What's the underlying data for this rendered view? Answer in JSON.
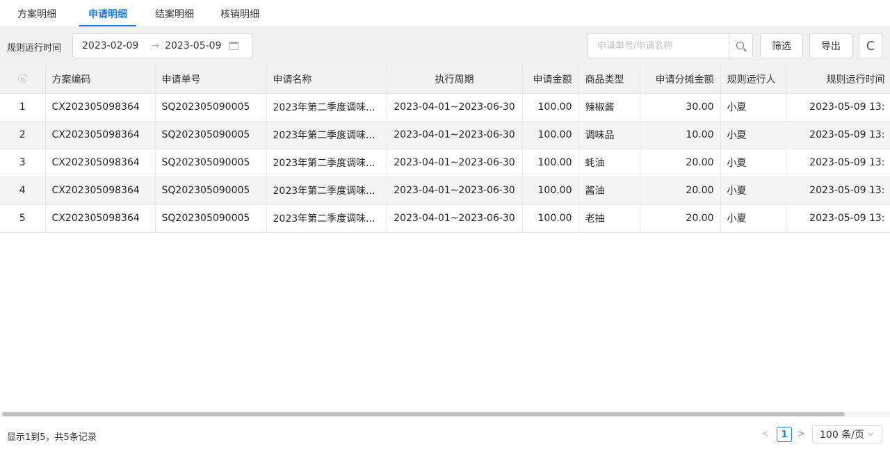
{
  "tabs": [
    {
      "label": "方案明细"
    },
    {
      "label": "申请明细"
    },
    {
      "label": "结案明细"
    },
    {
      "label": "核销明细"
    }
  ],
  "toolbar": {
    "date_label": "规则运行时间",
    "date_start": "2023-02-09",
    "date_sep": "→",
    "date_end": "2023-05-09",
    "search_placeholder": "申请单号/申请名称",
    "filter_label": "筛选",
    "export_label": "导出",
    "refresh_symbol": "C"
  },
  "table": {
    "columns": [
      "方案编码",
      "申请单号",
      "申请名称",
      "执行周期",
      "申请金额",
      "商品类型",
      "申请分摊金额",
      "规则运行人",
      "规则运行时间"
    ],
    "rows": [
      [
        "1",
        "CX202305098364",
        "SQ202305090005",
        "2023年第二季度调味...",
        "2023-04-01~2023-06-30",
        "100.00",
        "辣椒酱",
        "30.00",
        "小夏",
        "2023-05-09 13:"
      ],
      [
        "2",
        "CX202305098364",
        "SQ202305090005",
        "2023年第二季度调味...",
        "2023-04-01~2023-06-30",
        "100.00",
        "调味品",
        "10.00",
        "小夏",
        "2023-05-09 13:"
      ],
      [
        "3",
        "CX202305098364",
        "SQ202305090005",
        "2023年第二季度调味...",
        "2023-04-01~2023-06-30",
        "100.00",
        "蚝油",
        "20.00",
        "小夏",
        "2023-05-09 13:"
      ],
      [
        "4",
        "CX202305098364",
        "SQ202305090005",
        "2023年第二季度调味...",
        "2023-04-01~2023-06-30",
        "100.00",
        "酱油",
        "20.00",
        "小夏",
        "2023-05-09 13:"
      ],
      [
        "5",
        "CX202305098364",
        "SQ202305090005",
        "2023年第二季度调味...",
        "2023-04-01~2023-06-30",
        "100.00",
        "老抽",
        "20.00",
        "小夏",
        "2023-05-09 13:"
      ]
    ]
  },
  "footer": {
    "summary": "显示1到5，共5条记录",
    "prev": "<",
    "current_page": "1",
    "next": ">",
    "page_size": "100 条/页"
  },
  "colors": {
    "accent": "#1677ff",
    "toolbar_bg": "#f0f0f0",
    "header_bg": "#f2f2f2",
    "alt_row_bg": "#f4f4f4"
  }
}
